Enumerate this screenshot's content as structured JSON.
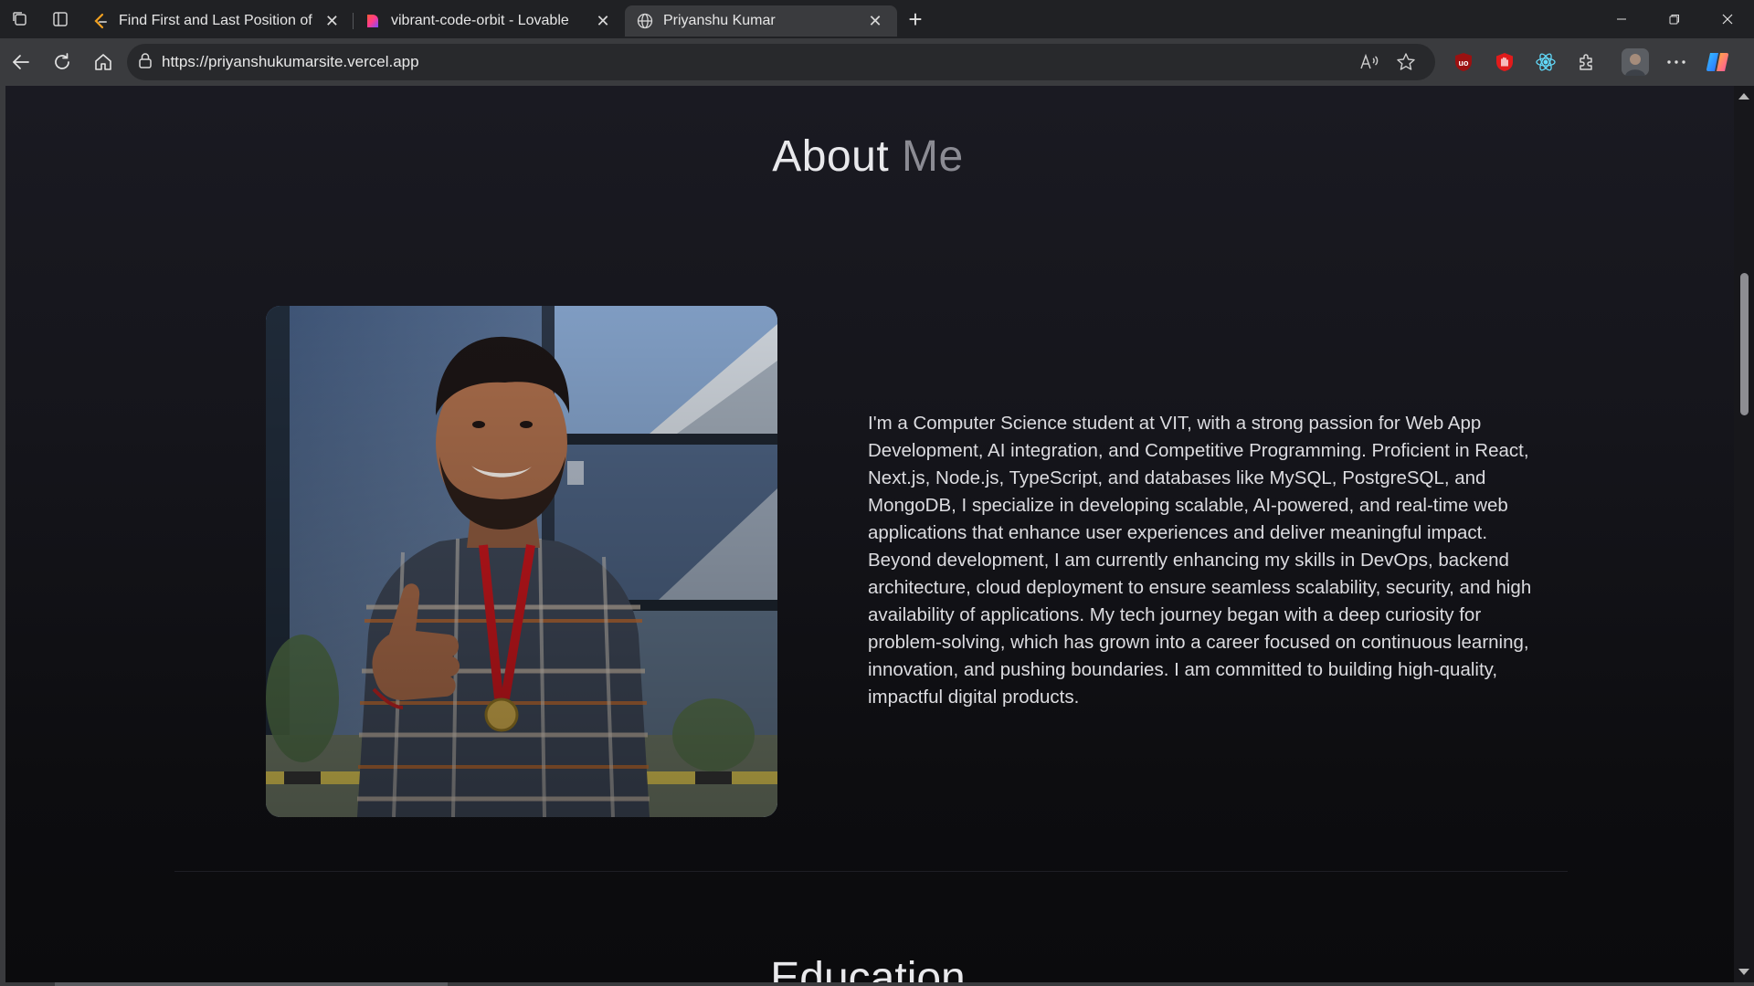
{
  "tabs": [
    {
      "title": "Find First and Last Position of Eler",
      "active": false,
      "icon": "leetcode-icon"
    },
    {
      "title": "vibrant-code-orbit - Lovable",
      "active": false,
      "icon": "lovable-heart-icon"
    },
    {
      "title": "Priyanshu Kumar",
      "active": true,
      "icon": "globe-icon"
    }
  ],
  "address_bar": {
    "url": "https://priyanshukumarsite.vercel.app"
  },
  "about": {
    "title_main": "About",
    "title_accent": "Me",
    "bio": "I'm a Computer Science student at VIT, with a strong passion for Web App Development, AI integration, and Competitive Programming. Proficient in React, Next.js, Node.js, TypeScript, and databases like MySQL, PostgreSQL, and MongoDB, I specialize in developing scalable, AI-powered, and real-time web applications that enhance user experiences and deliver meaningful impact. Beyond development, I am currently enhancing my skills in DevOps, backend architecture, cloud deployment to ensure seamless scalability, security, and high availability of applications. My tech journey began with a deep curiosity for problem-solving, which has grown into a career focused on continuous learning, innovation, and pushing boundaries. I am committed to building high-quality, impactful digital products."
  },
  "next_section": {
    "title": "Education"
  },
  "colors": {
    "browser_chrome": "#202124",
    "toolbar": "#3a3b3e",
    "page_background": "#14141a",
    "title_text": "#e9e9ec",
    "title_accent": "#8b8b93",
    "body_text": "#dcdce0"
  }
}
